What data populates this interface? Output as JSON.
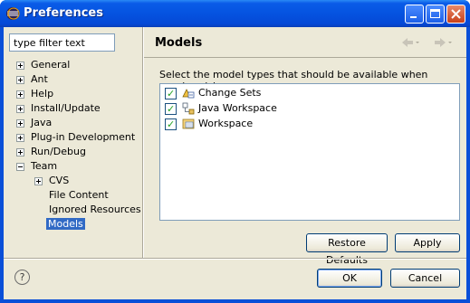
{
  "window": {
    "title": "Preferences"
  },
  "filter": {
    "placeholder": "type filter text",
    "value": "type filter text"
  },
  "tree": {
    "items": [
      {
        "label": "General",
        "expander": "plus"
      },
      {
        "label": "Ant",
        "expander": "plus"
      },
      {
        "label": "Help",
        "expander": "plus"
      },
      {
        "label": "Install/Update",
        "expander": "plus"
      },
      {
        "label": "Java",
        "expander": "plus"
      },
      {
        "label": "Plug-in Development",
        "expander": "plus"
      },
      {
        "label": "Run/Debug",
        "expander": "plus"
      },
      {
        "label": "Team",
        "expander": "minus"
      },
      {
        "label": "CVS",
        "expander": "plus"
      },
      {
        "label": "File Content",
        "expander": "none"
      },
      {
        "label": "Ignored Resources",
        "expander": "none"
      },
      {
        "label": "Models",
        "expander": "none",
        "selected": true
      }
    ]
  },
  "page": {
    "title": "Models",
    "description": "Select the model types that should be available when synchronizing",
    "models": [
      {
        "label": "Change Sets",
        "checked": true,
        "icon": "change-sets-icon"
      },
      {
        "label": "Java Workspace",
        "checked": true,
        "icon": "java-workspace-icon"
      },
      {
        "label": "Workspace",
        "checked": true,
        "icon": "workspace-icon"
      }
    ],
    "restore_label": "Restore Defaults",
    "apply_label": "Apply"
  },
  "footer": {
    "ok_label": "OK",
    "cancel_label": "Cancel",
    "help_glyph": "?"
  },
  "colors": {
    "titlebar": "#0553e0",
    "selection": "#316ac5",
    "dialog_bg": "#ece9d8"
  }
}
